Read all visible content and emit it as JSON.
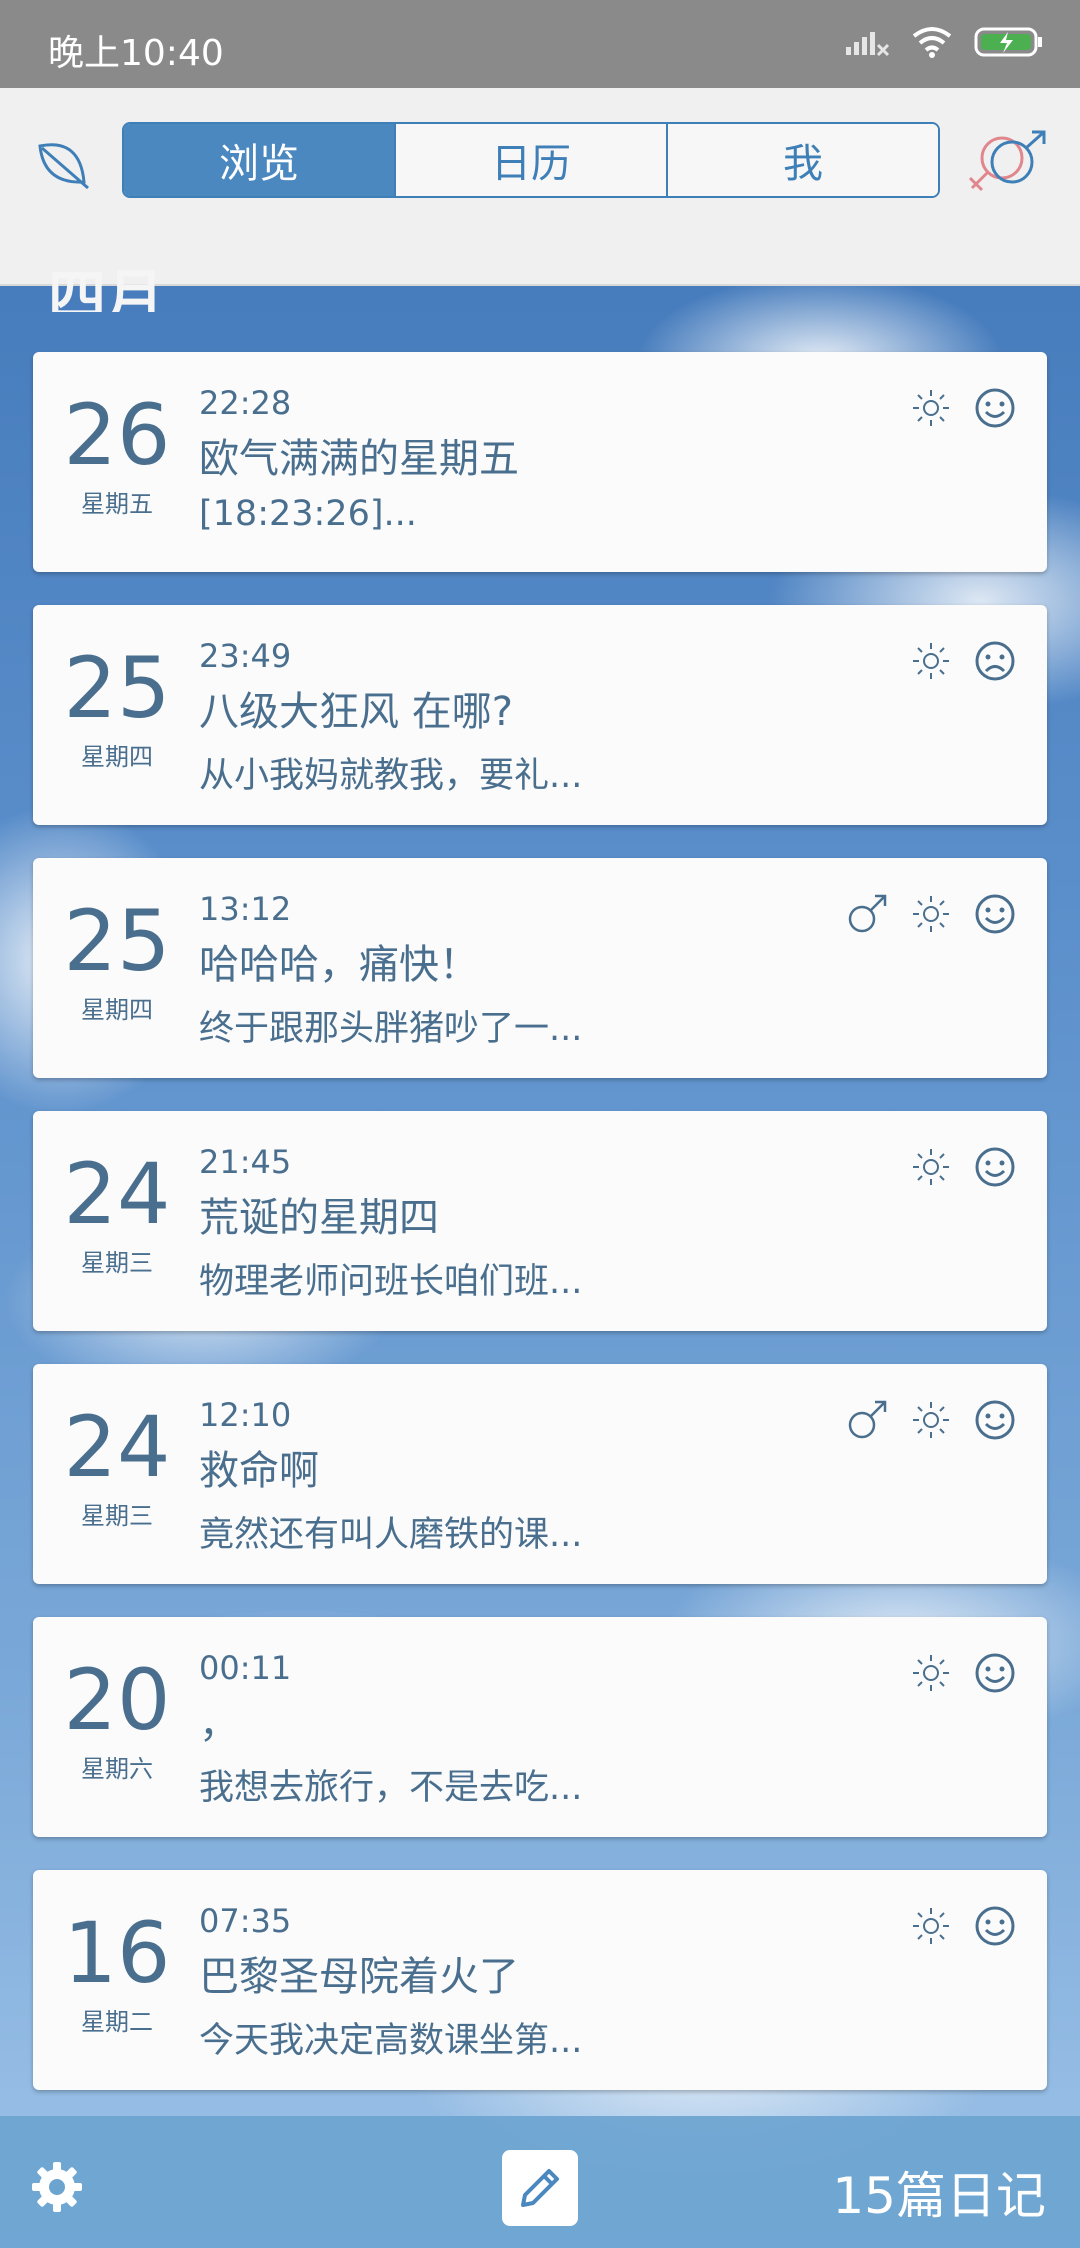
{
  "status_bar": {
    "time": "晚上10:40"
  },
  "header": {
    "tabs": [
      {
        "label": "浏览",
        "active": true
      },
      {
        "label": "日历",
        "active": false
      },
      {
        "label": "我",
        "active": false
      }
    ]
  },
  "month_label": "四月",
  "entries": [
    {
      "day": "26",
      "weekday": "星期五",
      "time": "22:28",
      "title": "欧气满满的星期五",
      "preview": "[18:23:26]...",
      "icons": [
        "sun-icon",
        "happy-face-icon"
      ]
    },
    {
      "day": "25",
      "weekday": "星期四",
      "time": "23:49",
      "title": "八级大狂风 在哪?",
      "preview": "从小我妈就教我，要礼...",
      "icons": [
        "sun-icon",
        "sad-face-icon"
      ]
    },
    {
      "day": "25",
      "weekday": "星期四",
      "time": "13:12",
      "title": "哈哈哈，痛快！",
      "preview": "终于跟那头胖猪吵了一...",
      "icons": [
        "male-icon",
        "sun-icon",
        "happy-face-icon"
      ]
    },
    {
      "day": "24",
      "weekday": "星期三",
      "time": "21:45",
      "title": "荒诞的星期四",
      "preview": "物理老师问班长咱们班...",
      "icons": [
        "sun-icon",
        "happy-face-icon"
      ]
    },
    {
      "day": "24",
      "weekday": "星期三",
      "time": "12:10",
      "title": "救命啊",
      "preview": "竟然还有叫人磨铁的课...",
      "icons": [
        "male-icon",
        "sun-icon",
        "happy-face-icon"
      ]
    },
    {
      "day": "20",
      "weekday": "星期六",
      "time": "00:11",
      "title": "，",
      "preview": "我想去旅行，不是去吃...",
      "icons": [
        "sun-icon",
        "happy-face-icon"
      ]
    },
    {
      "day": "16",
      "weekday": "星期二",
      "time": "07:35",
      "title": "巴黎圣母院着火了",
      "preview": "今天我决定高数课坐第...",
      "icons": [
        "sun-icon",
        "happy-face-icon"
      ]
    }
  ],
  "footer": {
    "entry_count": "15篇日记"
  },
  "colors": {
    "accent": "#4a88bf",
    "card_text": "#4a6f8e",
    "bottom_bar": "#6ca4d0"
  }
}
